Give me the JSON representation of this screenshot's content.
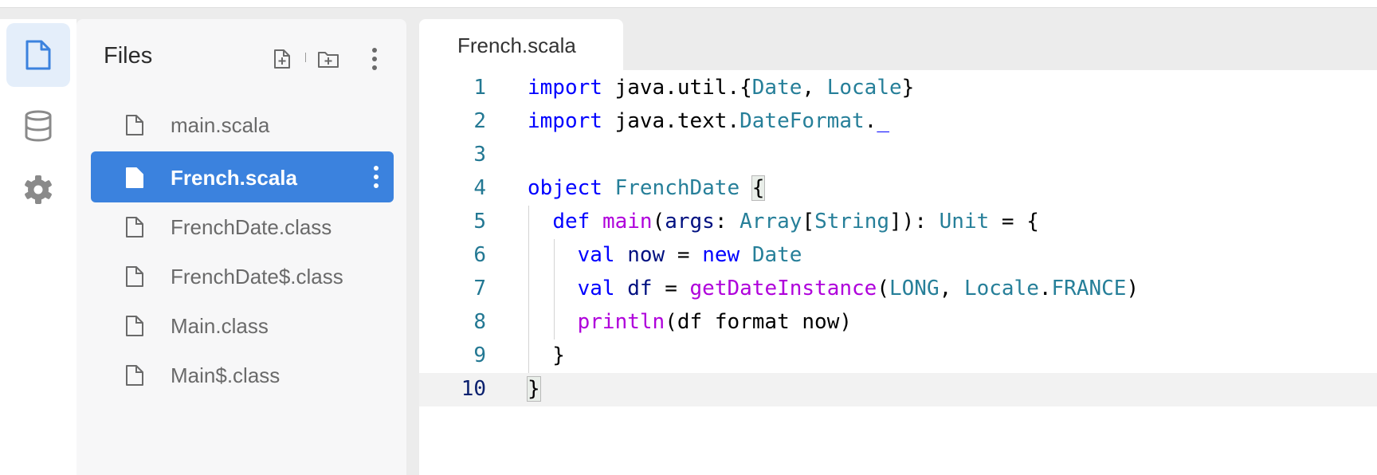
{
  "activity_bar": {
    "items": [
      {
        "name": "files",
        "icon": "file-icon",
        "active": true
      },
      {
        "name": "database",
        "icon": "database-icon",
        "active": false
      },
      {
        "name": "settings",
        "icon": "gear-icon",
        "active": false
      }
    ]
  },
  "file_panel": {
    "title": "Files",
    "toolbar": {
      "new_file_icon": "file-plus-icon",
      "new_folder_icon": "folder-plus-icon",
      "more_icon": "more-vertical-icon"
    },
    "files": [
      {
        "name": "main.scala",
        "selected": false
      },
      {
        "name": "French.scala",
        "selected": true
      },
      {
        "name": "FrenchDate.class",
        "selected": false
      },
      {
        "name": "FrenchDate$.class",
        "selected": false
      },
      {
        "name": "Main.class",
        "selected": false
      },
      {
        "name": "Main$.class",
        "selected": false
      }
    ]
  },
  "editor": {
    "tab": {
      "label": "French.scala"
    },
    "current_line": 10,
    "lines": [
      {
        "n": "1",
        "text": "import java.util.{Date, Locale}"
      },
      {
        "n": "2",
        "text": "import java.text.DateFormat._"
      },
      {
        "n": "3",
        "text": ""
      },
      {
        "n": "4",
        "text": "object FrenchDate {"
      },
      {
        "n": "5",
        "text": "  def main(args: Array[String]): Unit = {"
      },
      {
        "n": "6",
        "text": "    val now = new Date"
      },
      {
        "n": "7",
        "text": "    val df = getDateInstance(LONG, Locale.FRANCE)"
      },
      {
        "n": "8",
        "text": "    println(df format now)"
      },
      {
        "n": "9",
        "text": "  }"
      },
      {
        "n": "10",
        "text": "}"
      }
    ]
  },
  "colors": {
    "accent": "#3b82de",
    "keyword": "#0000ff",
    "type": "#267f99",
    "function": "#af00db",
    "variable": "#001080",
    "line_number": "#237893"
  }
}
